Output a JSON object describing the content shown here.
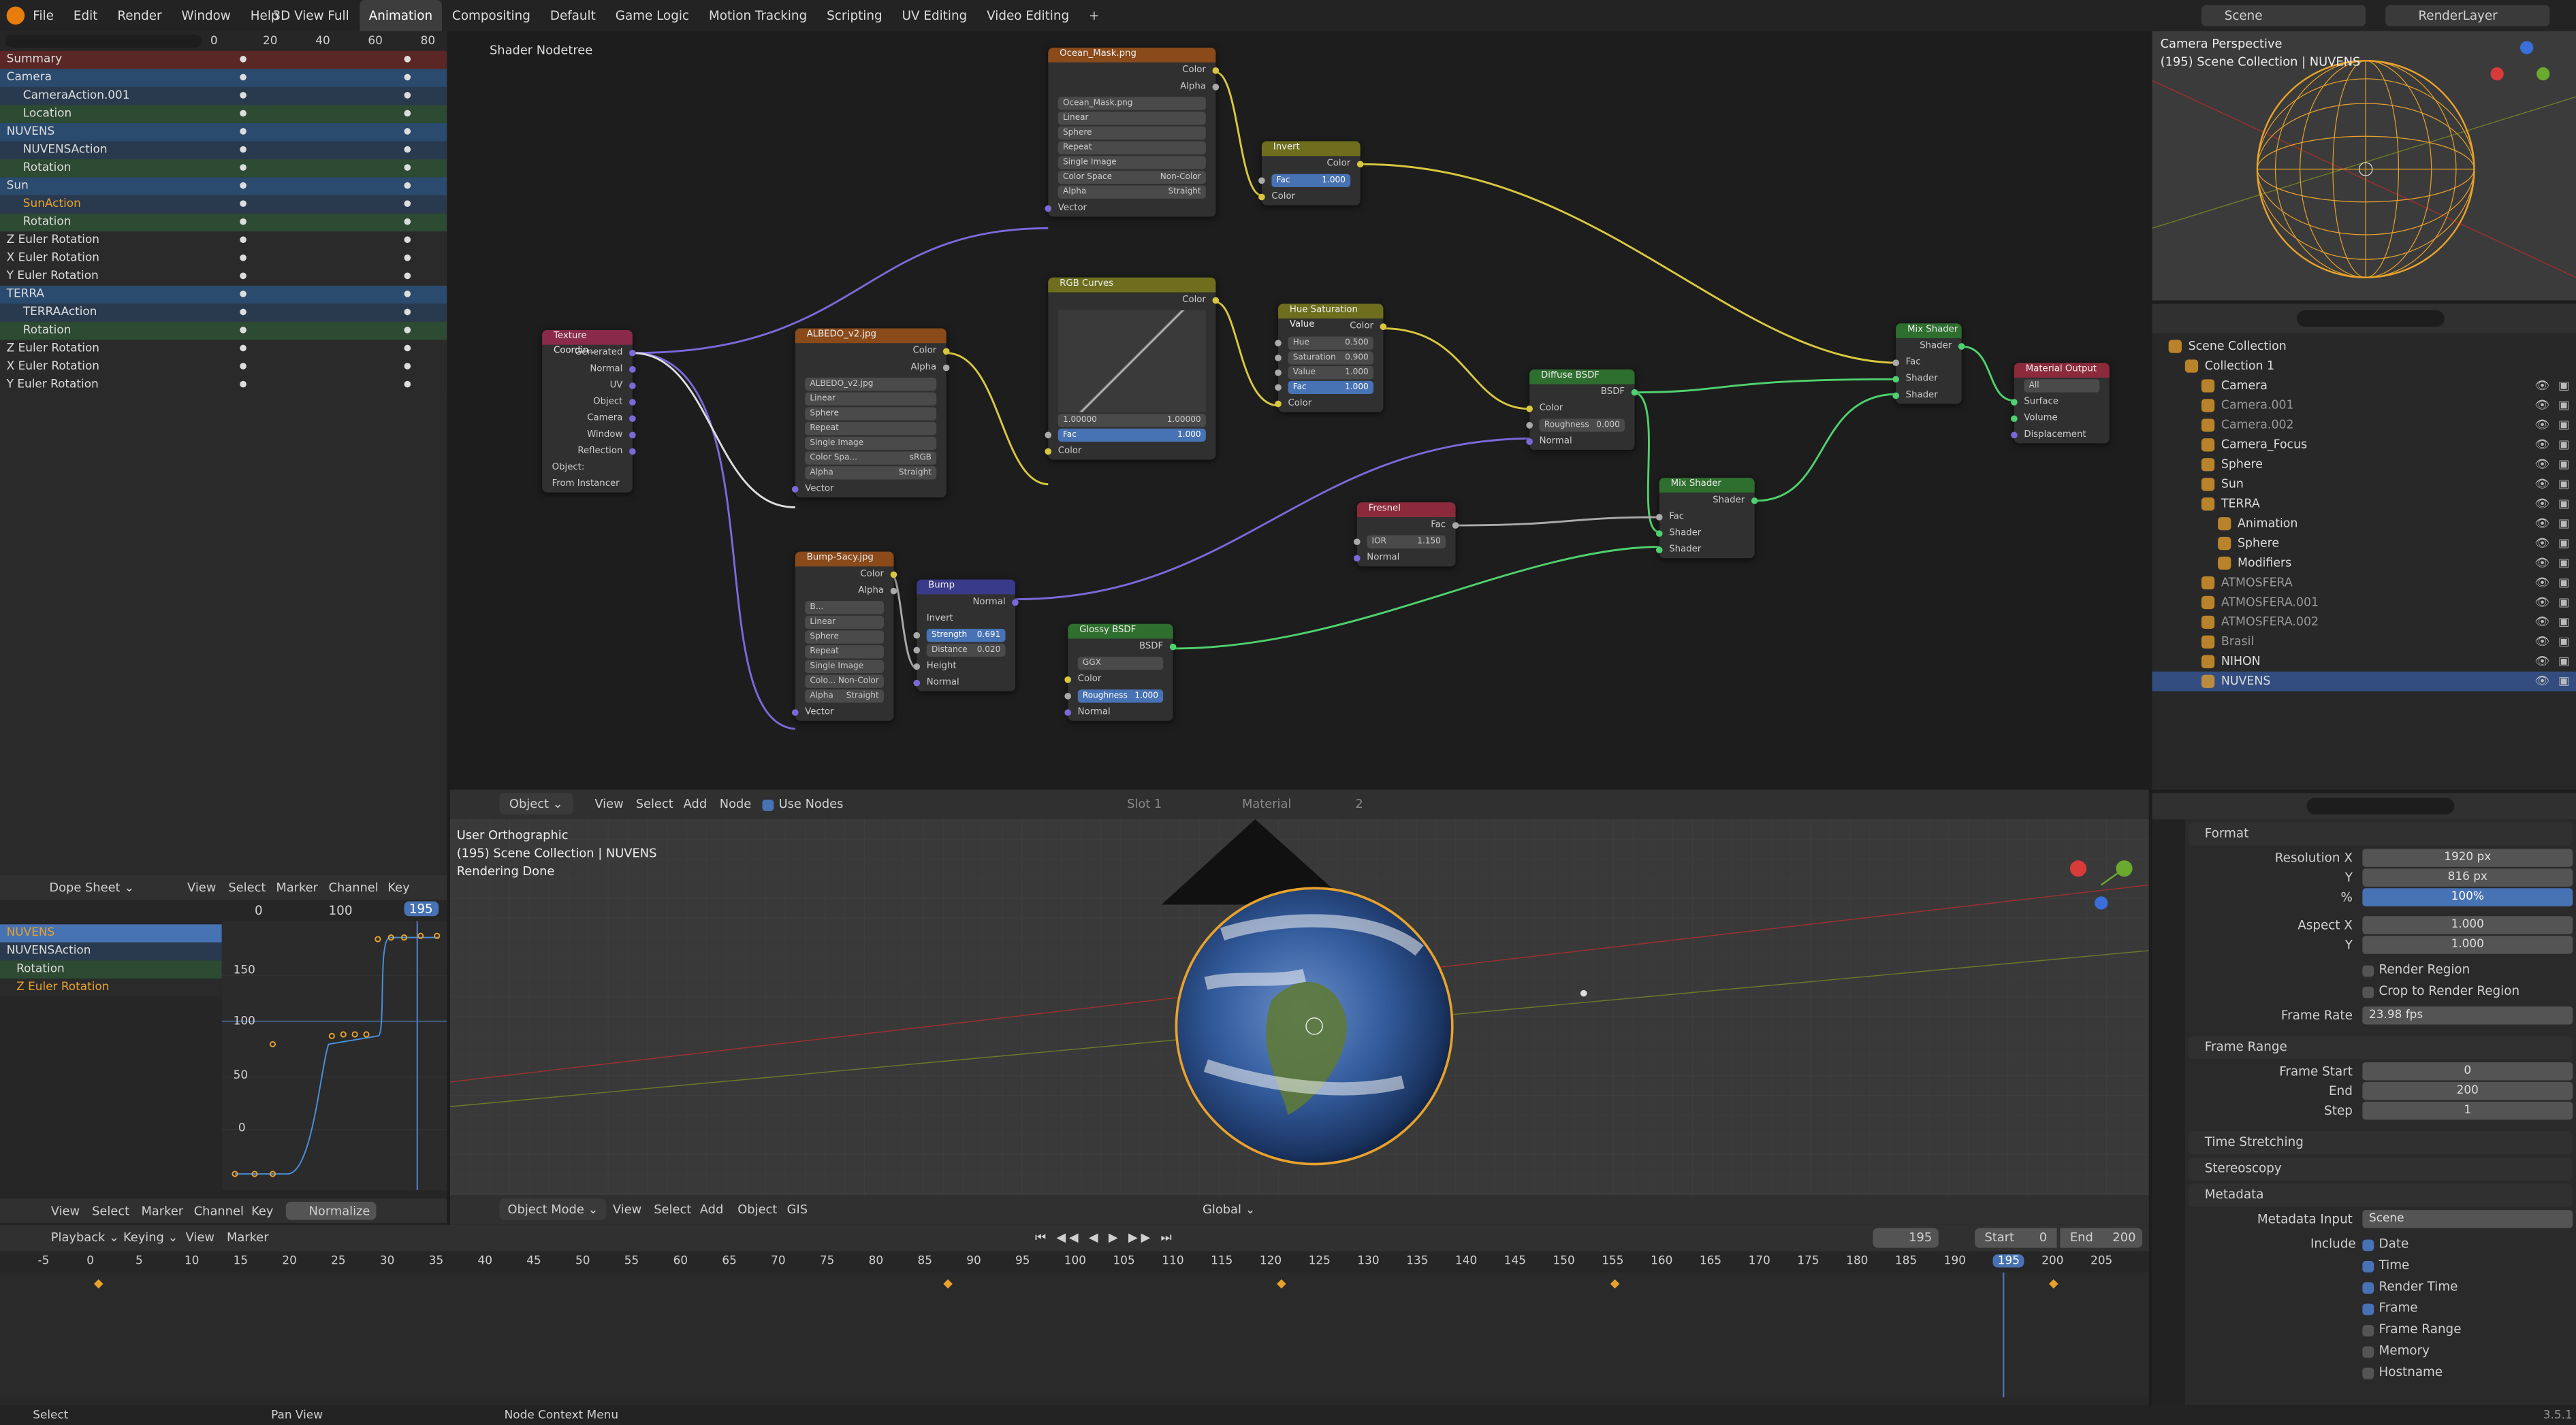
{
  "topbar": {
    "menus": [
      "File",
      "Edit",
      "Render",
      "Window",
      "Help"
    ],
    "workspaces": [
      "3D View Full",
      "Animation",
      "Compositing",
      "Default",
      "Game Logic",
      "Motion Tracking",
      "Scripting",
      "UV Editing",
      "Video Editing"
    ],
    "active_workspace": "Animation",
    "add_tab": "+",
    "scene": "Scene",
    "view_layer": "RenderLayer"
  },
  "dopesheet_top": {
    "ruler": [
      "0",
      "20",
      "40",
      "60",
      "80"
    ],
    "rows": [
      "Summary",
      "Camera",
      "CameraAction.001",
      "Location",
      "NUVENS",
      "NUVENSAction",
      "Rotation",
      "Sun",
      "SunAction",
      "Rotation",
      "Z Euler Rotation",
      "X Euler Rotation",
      "Y Euler Rotation",
      "TERRA",
      "TERRAAction",
      "Rotation",
      "Z Euler Rotation",
      "X Euler Rotation",
      "Y Euler Rotation"
    ]
  },
  "graph_editor": {
    "header": {
      "view": "View",
      "select": "Select",
      "marker": "Marker",
      "channel": "Channel",
      "key": "Key",
      "mode": "Dope Sheet"
    },
    "ruler": [
      "0",
      "100",
      "195"
    ],
    "channels": [
      "NUVENS",
      "NUVENSAction",
      "Rotation",
      "Z Euler Rotation"
    ],
    "yticks": [
      "150",
      "100",
      "50",
      "0"
    ],
    "footer": {
      "view": "View",
      "select": "Select",
      "marker": "Marker",
      "channel": "Channel",
      "key": "Key",
      "normalize": "Normalize"
    }
  },
  "node_editor": {
    "title": "Shader Nodetree",
    "header": {
      "object": "Object",
      "view": "View",
      "select": "Select",
      "add": "Add",
      "node": "Node",
      "use_nodes": "Use Nodes",
      "slot": "Slot 1",
      "material": "Material",
      "users": "2"
    },
    "nodes": {
      "ocean": {
        "title": "Ocean_Mask.png",
        "out1": "Color",
        "out2": "Alpha",
        "file": "Ocean_Mask.png",
        "interp": "Linear",
        "proj": "Sphere",
        "ext": "Repeat",
        "src": "Single Image",
        "cs_label": "Color Space",
        "cs": "Non-Color",
        "alpha": "Alpha",
        "alpha_mode": "Straight",
        "in": "Vector"
      },
      "invert": {
        "title": "Invert",
        "out": "Color",
        "fac": "Fac",
        "fac_val": "1.000",
        "in": "Color"
      },
      "texcoord": {
        "title": "Texture Coordin...",
        "outs": [
          "Generated",
          "Normal",
          "UV",
          "Object",
          "Camera",
          "Window",
          "Reflection"
        ],
        "obj": "Object:",
        "inst": "From Instancer"
      },
      "albedo": {
        "title": "ALBEDO_v2.jpg",
        "out1": "Color",
        "out2": "Alpha",
        "file": "ALBEDO_v2.jpg",
        "interp": "Linear",
        "proj": "Sphere",
        "ext": "Repeat",
        "src": "Single Image",
        "cs_label": "Color Spa...",
        "cs": "sRGB",
        "alpha": "Alpha",
        "alpha_mode": "Straight",
        "in": "Vector"
      },
      "curves": {
        "title": "RGB Curves",
        "out": "Color",
        "tabs": [
          "C",
          "R",
          "G",
          "B"
        ],
        "v1": "1.00000",
        "v2": "1.00000",
        "fac": "Fac",
        "fac_val": "1.000",
        "in": "Color"
      },
      "hsv": {
        "title": "Hue Saturation Value",
        "out": "Color",
        "hue": "Hue",
        "hue_val": "0.500",
        "sat": "Saturation",
        "sat_val": "0.900",
        "val": "Value",
        "val_val": "1.000",
        "fac": "Fac",
        "fac_val": "1.000",
        "in": "Color"
      },
      "diffuse": {
        "title": "Diffuse BSDF",
        "out": "BSDF",
        "color": "Color",
        "rough": "Roughness",
        "rough_val": "0.000",
        "normal": "Normal"
      },
      "mix1": {
        "title": "Mix Shader",
        "out": "Shader",
        "fac": "Fac",
        "s1": "Shader",
        "s2": "Shader"
      },
      "matout": {
        "title": "Material Output",
        "target": "All",
        "surface": "Surface",
        "volume": "Volume",
        "disp": "Displacement"
      },
      "bumptex": {
        "title": "Bump-5acy.jpg",
        "out1": "Color",
        "out2": "Alpha",
        "file": "B...",
        "interp": "Linear",
        "proj": "Sphere",
        "ext": "Repeat",
        "src": "Single Image",
        "cs_label": "Colo...",
        "cs": "Non-Color",
        "alpha": "Alpha",
        "alpha_mode": "Straight",
        "in": "Vector"
      },
      "bump": {
        "title": "Bump",
        "out": "Normal",
        "invert": "Invert",
        "strength": "Strength",
        "strength_val": "0.691",
        "dist": "Distance",
        "dist_val": "0.020",
        "height": "Height",
        "normal": "Normal"
      },
      "fresnel": {
        "title": "Fresnel",
        "out": "Fac",
        "ior": "IOR",
        "ior_val": "1.150",
        "normal": "Normal"
      },
      "mix2": {
        "title": "Mix Shader",
        "out": "Shader",
        "fac": "Fac",
        "s1": "Shader",
        "s2": "Shader"
      },
      "glossy": {
        "title": "Glossy BSDF",
        "out": "BSDF",
        "dist": "GGX",
        "color": "Color",
        "rough": "Roughness",
        "rough_val": "1.000",
        "normal": "Normal"
      }
    }
  },
  "viewport_small": {
    "line1": "Camera Perspective",
    "line2": "(195) Scene Collection | NUVENS"
  },
  "viewport_main": {
    "line1": "User Orthographic",
    "line2": "(195) Scene Collection | NUVENS",
    "line3": "Rendering Done",
    "header": {
      "mode": "Object Mode",
      "view": "View",
      "select": "Select",
      "add": "Add",
      "object": "Object",
      "gis": "GIS",
      "orient": "Global"
    }
  },
  "outliner": {
    "items": [
      {
        "name": "Scene Collection",
        "indent": 0
      },
      {
        "name": "Collection 1",
        "indent": 1
      },
      {
        "name": "Camera",
        "indent": 2
      },
      {
        "name": "Camera.001",
        "indent": 2
      },
      {
        "name": "Camera.002",
        "indent": 2
      },
      {
        "name": "Camera_Focus",
        "indent": 2
      },
      {
        "name": "Sphere",
        "indent": 2
      },
      {
        "name": "Sun",
        "indent": 2
      },
      {
        "name": "TERRA",
        "indent": 2
      },
      {
        "name": "Animation",
        "indent": 3
      },
      {
        "name": "Sphere",
        "indent": 3
      },
      {
        "name": "Modifiers",
        "indent": 3
      },
      {
        "name": "ATMOSFERA",
        "indent": 2
      },
      {
        "name": "ATMOSFERA.001",
        "indent": 2
      },
      {
        "name": "ATMOSFERA.002",
        "indent": 2
      },
      {
        "name": "Brasil",
        "indent": 2
      },
      {
        "name": "NIHON",
        "indent": 2
      },
      {
        "name": "NUVENS",
        "indent": 2
      }
    ]
  },
  "properties": {
    "format": "Format",
    "res_x": "Resolution X",
    "res_x_val": "1920 px",
    "res_y": "Y",
    "res_y_val": "816 px",
    "pct": "%",
    "pct_val": "100%",
    "aspect_x": "Aspect X",
    "aspect_x_val": "1.000",
    "aspect_y": "Y",
    "aspect_y_val": "1.000",
    "render_region": "Render Region",
    "crop": "Crop to Render Region",
    "frame_rate": "Frame Rate",
    "frame_rate_val": "23.98 fps",
    "frame_range": "Frame Range",
    "frame_start": "Frame Start",
    "frame_start_val": "0",
    "end": "End",
    "end_val": "200",
    "step": "Step",
    "step_val": "1",
    "time_stretching": "Time Stretching",
    "stereoscopy": "Stereoscopy",
    "metadata": "Metadata",
    "metadata_input": "Metadata Input",
    "metadata_input_val": "Scene",
    "include": "Include",
    "meta_items": [
      {
        "label": "Date",
        "on": true
      },
      {
        "label": "Time",
        "on": true
      },
      {
        "label": "Render Time",
        "on": true
      },
      {
        "label": "Frame",
        "on": true
      },
      {
        "label": "Frame Range",
        "on": false
      },
      {
        "label": "Memory",
        "on": false
      },
      {
        "label": "Hostname",
        "on": false
      }
    ]
  },
  "timeline": {
    "header": {
      "playback": "Playback",
      "keying": "Keying",
      "view": "View",
      "marker": "Marker",
      "current": "195",
      "start_label": "Start",
      "start": "0",
      "end_label": "End",
      "end": "200"
    },
    "ruler": [
      "-5",
      "0",
      "5",
      "10",
      "15",
      "20",
      "25",
      "30",
      "35",
      "40",
      "45",
      "50",
      "55",
      "60",
      "65",
      "70",
      "75",
      "80",
      "85",
      "90",
      "95",
      "100",
      "105",
      "110",
      "115",
      "120",
      "125",
      "130",
      "135",
      "140",
      "145",
      "150",
      "155",
      "160",
      "165",
      "170",
      "175",
      "180",
      "185",
      "190",
      "195",
      "200",
      "205"
    ],
    "current_frame": "195"
  },
  "statusbar": {
    "select": "Select",
    "pan": "Pan View",
    "context": "Node Context Menu",
    "version": "3.5.1"
  },
  "colors": {
    "accent": "#4772b3",
    "orange": "#e8a22c",
    "bg": "#1d1d1d",
    "panel": "#282828"
  }
}
